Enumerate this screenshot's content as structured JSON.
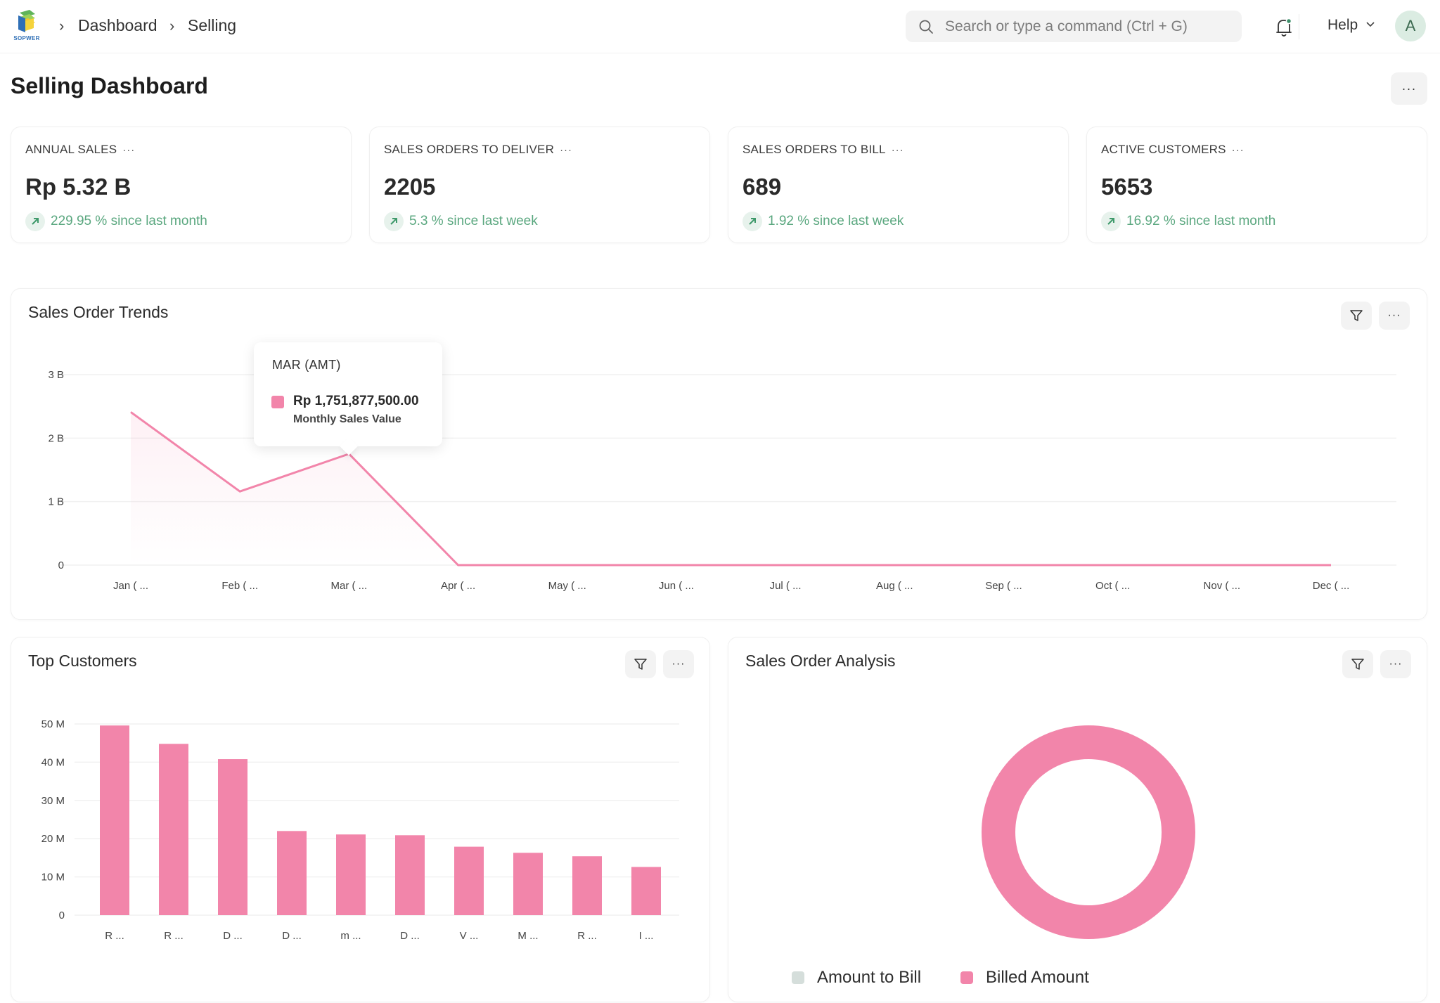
{
  "navbar": {
    "logo_text": "SOPWER",
    "breadcrumbs": [
      "Dashboard",
      "Selling"
    ],
    "search_placeholder": "Search or type a command (Ctrl + G)",
    "help_label": "Help",
    "avatar_initial": "A"
  },
  "page": {
    "title": "Selling Dashboard",
    "menu_label": "···"
  },
  "number_cards": [
    {
      "label": "ANNUAL SALES",
      "value": "Rp 5.32 B",
      "trend": "229.95 % since last month",
      "direction": "up"
    },
    {
      "label": "SALES ORDERS TO DELIVER",
      "value": "2205",
      "trend": "5.3 % since last week",
      "direction": "up"
    },
    {
      "label": "SALES ORDERS TO BILL",
      "value": "689",
      "trend": "1.92 % since last week",
      "direction": "up"
    },
    {
      "label": "ACTIVE CUSTOMERS",
      "value": "5653",
      "trend": "16.92 % since last month",
      "direction": "up"
    }
  ],
  "card_menu_label": "···",
  "colors": {
    "accent_pink": "#f285aa",
    "trend_green": "#5aa77f",
    "legend_grey": "#d5dedb"
  },
  "tooltip": {
    "title": "MAR (AMT)",
    "value": "Rp 1,751,877,500.00",
    "series": "Monthly Sales Value"
  },
  "chart_data": [
    {
      "type": "line",
      "title": "Sales Order Trends",
      "categories": [
        "Jan ( ...",
        "Feb ( ...",
        "Mar ( ...",
        "Apr ( ...",
        "May ( ...",
        "Jun ( ...",
        "Jul ( ...",
        "Aug ( ...",
        "Sep ( ...",
        "Oct ( ...",
        "Nov ( ...",
        "Dec ( ..."
      ],
      "series": [
        {
          "name": "Monthly Sales Value",
          "values": [
            2410000000,
            1160000000,
            1751877500,
            0,
            0,
            0,
            0,
            0,
            0,
            0,
            0,
            0
          ]
        }
      ],
      "y_ticks": [
        "0",
        "1 B",
        "2 B",
        "3 B"
      ],
      "ylim": [
        0,
        3000000000
      ],
      "grid": true,
      "xlabel": "",
      "ylabel": ""
    },
    {
      "type": "bar",
      "title": "Top Customers",
      "categories": [
        "R ...",
        "R ...",
        "D ...",
        "D ...",
        "m ...",
        "D ...",
        "V ...",
        "M ...",
        "R ...",
        "I ..."
      ],
      "values": [
        49.6,
        44.8,
        40.8,
        22.0,
        21.1,
        20.9,
        17.9,
        16.3,
        15.4,
        12.6
      ],
      "units": "M",
      "y_ticks": [
        "0",
        "10 M",
        "20 M",
        "30 M",
        "40 M",
        "50 M"
      ],
      "ylim": [
        0,
        50
      ],
      "grid": true,
      "xlabel": "",
      "ylabel": ""
    },
    {
      "type": "pie",
      "title": "Sales Order Analysis",
      "donut": true,
      "labels": [
        "Amount to Bill",
        "Billed Amount"
      ],
      "values": [
        0,
        100
      ],
      "colors": [
        "#d5dedb",
        "#f285aa"
      ],
      "legend": "bottom"
    }
  ]
}
